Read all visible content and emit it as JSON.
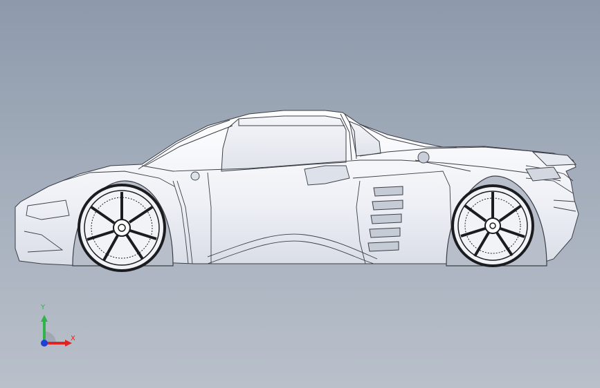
{
  "viewport": {
    "background_top": "#8d9aab",
    "background_bottom": "#b9c0ca"
  },
  "model": {
    "line_color": "#3a3d44",
    "body_fill": "#eef0f6",
    "shade_fill": "#cfd4de"
  },
  "triad": {
    "y_label": "Y",
    "x_label": "X",
    "y_color": "#2fb34a",
    "x_color": "#e02424",
    "z_color": "#1e3fd8"
  }
}
